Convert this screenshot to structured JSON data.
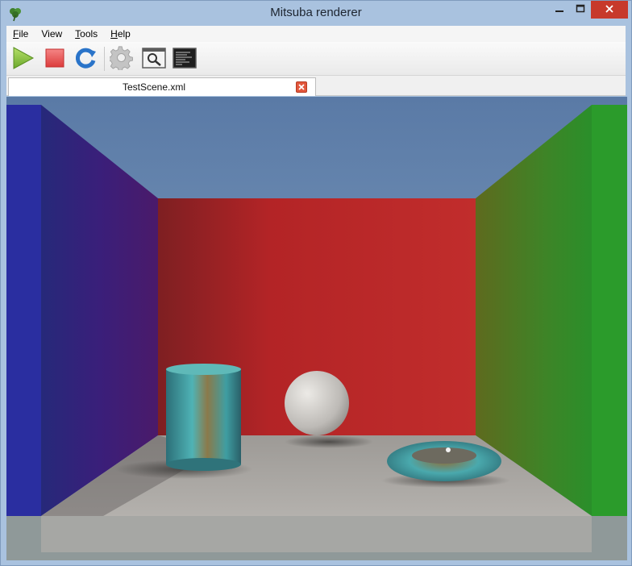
{
  "window": {
    "title": "Mitsuba renderer",
    "app_icon": "clover-icon",
    "controls": {
      "minimize": "minimize-icon",
      "maximize": "maximize-icon",
      "close": "close-icon"
    }
  },
  "menu": {
    "items": [
      {
        "label": "File",
        "accelerator": "F",
        "rest": "ile"
      },
      {
        "label": "View",
        "accelerator": "",
        "rest": "View"
      },
      {
        "label": "Tools",
        "accelerator": "T",
        "rest": "ools"
      },
      {
        "label": "Help",
        "accelerator": "H",
        "rest": "elp"
      }
    ]
  },
  "toolbar": {
    "buttons": [
      {
        "name": "start-render",
        "icon": "play-icon"
      },
      {
        "name": "stop-render",
        "icon": "stop-icon"
      },
      {
        "name": "refresh",
        "icon": "refresh-icon"
      },
      {
        "name": "settings",
        "icon": "gear-icon"
      },
      {
        "name": "preview",
        "icon": "magnifier-icon"
      },
      {
        "name": "console",
        "icon": "console-icon"
      }
    ]
  },
  "tabs": [
    {
      "label": "TestScene.xml",
      "active": true
    }
  ],
  "colors": {
    "titlebar": "#a9c2df",
    "close_button": "#c7392b",
    "play": "#8ec63f",
    "stop": "#e84b4b",
    "refresh": "#2a74c9",
    "wall_left": "#2a2ea0",
    "wall_back": "#b8282a",
    "wall_right": "#2c9a2c",
    "floor": "#a7a4a0"
  }
}
